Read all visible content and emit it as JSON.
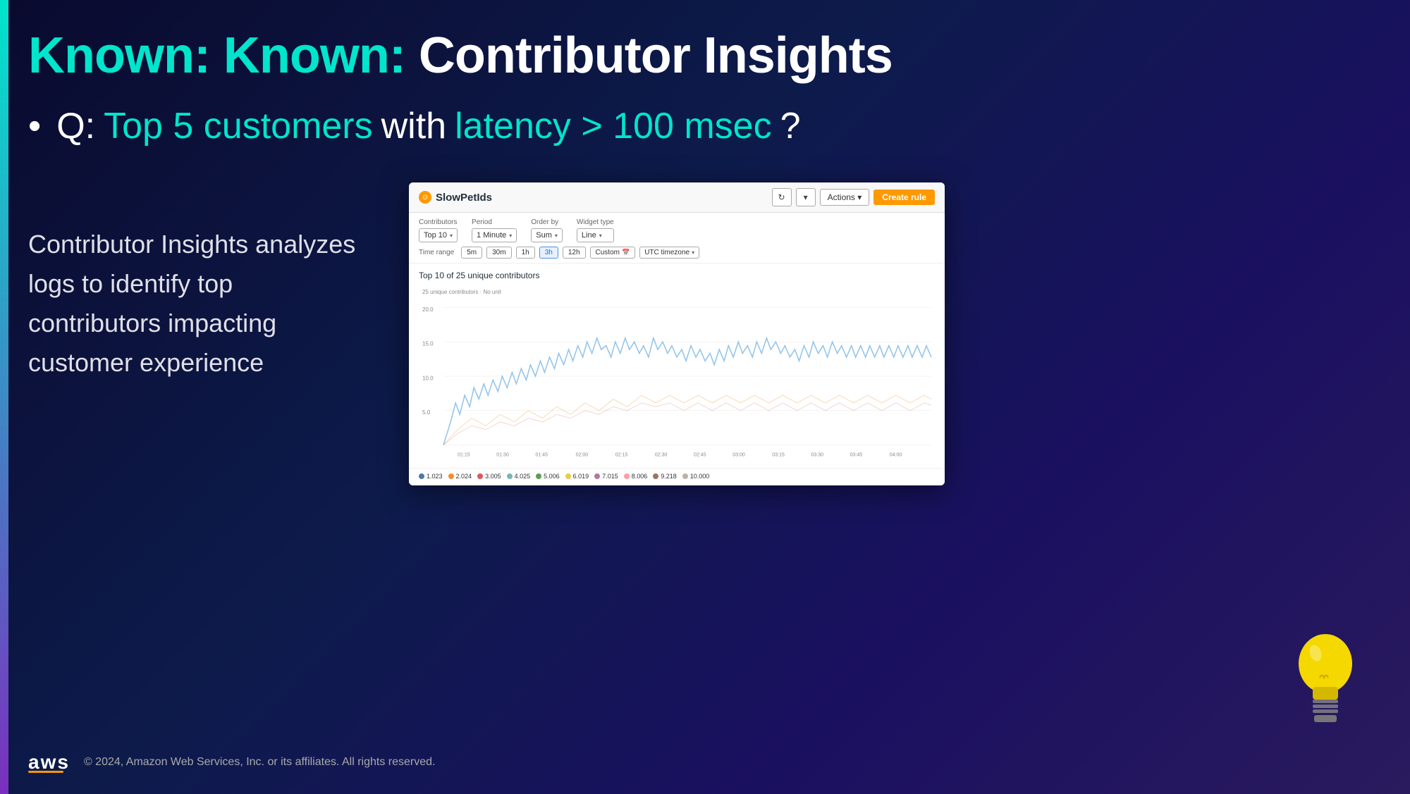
{
  "slide": {
    "title": {
      "part1": "Known: Known: ",
      "part2": "Contributor Insights"
    },
    "question": {
      "bullet": "•",
      "q_label": "Q:",
      "top_customers": " Top 5 customers",
      "with": " with",
      "latency": " latency > 100 msec",
      "end": "?"
    },
    "left_text": "Contributor Insights analyzes logs to identify top contributors impacting customer experience",
    "panel": {
      "title": "SlowPetIds",
      "btn_refresh": "↻",
      "btn_dropdown": "▾",
      "btn_actions": "Actions ▾",
      "btn_create_rule": "Create rule",
      "controls": {
        "contributors_label": "Contributors",
        "contributors_value": "Top 10",
        "period_label": "Period",
        "period_value": "1 Minute",
        "order_by_label": "Order by",
        "order_by_value": "Sum",
        "widget_type_label": "Widget type",
        "widget_type_value": "Line"
      },
      "time_range": {
        "label": "Time range",
        "options": [
          "5m",
          "30m",
          "1h",
          "3h",
          "12h"
        ],
        "active": "3h",
        "custom": "Custom",
        "timezone": "UTC timezone"
      },
      "chart": {
        "title": "Top 10 of 25 unique contributors",
        "y_label1": "25 unique contributors · No unit",
        "y_values": [
          "20.0",
          "15.0",
          "10.0",
          "5.0"
        ],
        "x_labels": [
          "01:15",
          "01:30",
          "01:45",
          "02:00",
          "02:15",
          "02:30",
          "02:45",
          "03:00",
          "03:15",
          "03:30",
          "03:45",
          "04:00"
        ]
      },
      "legend": [
        {
          "color": "#4e79a7",
          "label": "1.023"
        },
        {
          "color": "#f28e2b",
          "label": "2.024"
        },
        {
          "color": "#e15759",
          "label": "3.005"
        },
        {
          "color": "#76b7b2",
          "label": "4.025"
        },
        {
          "color": "#59a14f",
          "label": "5.006"
        },
        {
          "color": "#edc948",
          "label": "6.019"
        },
        {
          "color": "#b07aa1",
          "label": "7.015"
        },
        {
          "color": "#ff9da7",
          "label": "8.006"
        },
        {
          "color": "#9c755f",
          "label": "9.218"
        },
        {
          "color": "#bab0ac",
          "label": "10.000"
        }
      ]
    },
    "footer": {
      "aws_label": "aws",
      "copyright": "© 2024, Amazon Web Services, Inc. or its affiliates. All rights reserved."
    }
  }
}
